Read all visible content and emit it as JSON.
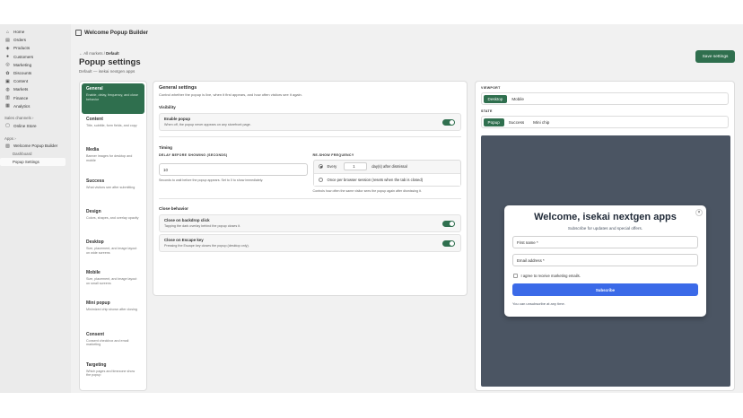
{
  "nav": {
    "items": [
      {
        "label": "Home",
        "icon": "home-icon"
      },
      {
        "label": "Orders",
        "icon": "orders-icon"
      },
      {
        "label": "Products",
        "icon": "products-icon"
      },
      {
        "label": "Customers",
        "icon": "customers-icon"
      },
      {
        "label": "Marketing",
        "icon": "marketing-icon"
      },
      {
        "label": "Discounts",
        "icon": "discounts-icon"
      },
      {
        "label": "Content",
        "icon": "content-icon"
      },
      {
        "label": "Markets",
        "icon": "markets-icon"
      },
      {
        "label": "Finance",
        "icon": "finance-icon"
      },
      {
        "label": "Analytics",
        "icon": "analytics-icon"
      }
    ],
    "sales_channels_label": "Sales channels",
    "online_store": "Online Store",
    "apps_label": "Apps",
    "app_name": "Welcome Popup Builder",
    "dashboard": "Dashboard",
    "popup_settings": "Popup Settings"
  },
  "appbar": {
    "title": "Welcome Popup Builder"
  },
  "page": {
    "crumb_back": "← All markets",
    "crumb_sep": "/",
    "crumb_current": "Default",
    "title": "Popup settings",
    "subtitle": "Default — isekai nextgen apps",
    "save_label": "Save settings"
  },
  "sections": [
    {
      "title": "General",
      "desc": "Enable, delay, frequency, and close behavior"
    },
    {
      "title": "Content",
      "desc": "Title, subtitle, form fields, and copy"
    },
    {
      "title": "Media",
      "desc": "Banner images for desktop and mobile"
    },
    {
      "title": "Success",
      "desc": "What visitors see after submitting"
    },
    {
      "title": "Design",
      "desc": "Colors, shapes, and overlay opacity"
    },
    {
      "title": "Desktop",
      "desc": "Size, placement, and image layout on wide screens"
    },
    {
      "title": "Mobile",
      "desc": "Size, placement, and image layout on small screens"
    },
    {
      "title": "Mini popup",
      "desc": "Minimized chip shown after closing"
    },
    {
      "title": "Consent",
      "desc": "Consent checkbox and email marketing"
    },
    {
      "title": "Targeting",
      "desc": "Which pages and timezone show the popup"
    }
  ],
  "general": {
    "title": "General settings",
    "desc": "Control whether the popup is live, when it first appears, and how often visitors see it again.",
    "visibility_title": "Visibility",
    "enable_title": "Enable popup",
    "enable_desc": "When off, the popup never appears on any storefront page.",
    "timing_title": "Timing",
    "delay_label": "DELAY BEFORE SHOWING (SECONDS)",
    "delay_value": "10",
    "delay_help": "Seconds to wait before the popup appears. Set to 0 to show immediately.",
    "freq_label": "RE-SHOW FREQUENCY",
    "every_label": "Every",
    "every_value": "1",
    "every_suffix": "day(s) after dismissal",
    "once_label": "Once per browser session (resets when the tab is closed)",
    "freq_help": "Controls how often the same visitor sees the popup again after dismissing it.",
    "close_title": "Close behavior",
    "backdrop_title": "Close on backdrop click",
    "backdrop_desc": "Tapping the dark overlay behind the popup closes it.",
    "escape_title": "Close on Escape key",
    "escape_desc": "Pressing the Escape key closes the popup (desktop only)."
  },
  "preview": {
    "viewport_label": "VIEWPORT",
    "viewport_options": [
      "Desktop",
      "Mobile"
    ],
    "state_label": "STATE",
    "state_options": [
      "Popup",
      "Success",
      "Mini chip"
    ],
    "popup_title": "Welcome, isekai nextgen apps",
    "popup_sub": "Subscribe for updates and special offers.",
    "first_name": "First name *",
    "email": "Email address *",
    "consent": "I agree to receive marketing emails.",
    "button": "Subscribe",
    "footer": "You can unsubscribe at any time.",
    "close": "×"
  },
  "colors": {
    "accent": "#2f6f4e",
    "popup_button": "#3b6ae8",
    "canvas": "#4b5563"
  }
}
